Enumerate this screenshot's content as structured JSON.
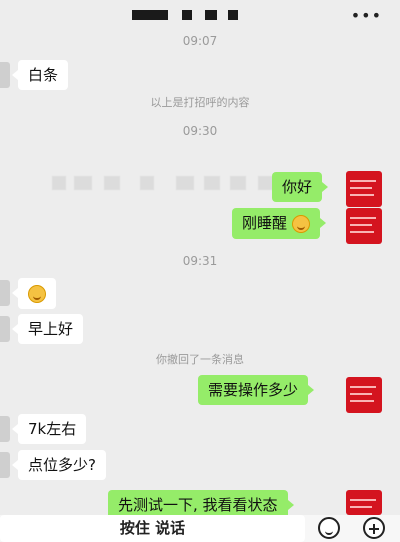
{
  "header": {
    "more": "•••"
  },
  "chat": {
    "timestamps": [
      "09:07",
      "09:30",
      "09:31"
    ],
    "notices": {
      "greeting": "以上是打招呼的内容",
      "recall": "你撤回了一条消息"
    },
    "messages": {
      "m1": "白条",
      "m2": "你好",
      "m3": "刚睡醒",
      "m5": "早上好",
      "m6": "需要操作多少",
      "m7": "7k左右",
      "m8": "点位多少?",
      "m9": "先测试一下, 我看看状态"
    }
  },
  "toolbar": {
    "hold_to_talk": "按住 说话"
  }
}
